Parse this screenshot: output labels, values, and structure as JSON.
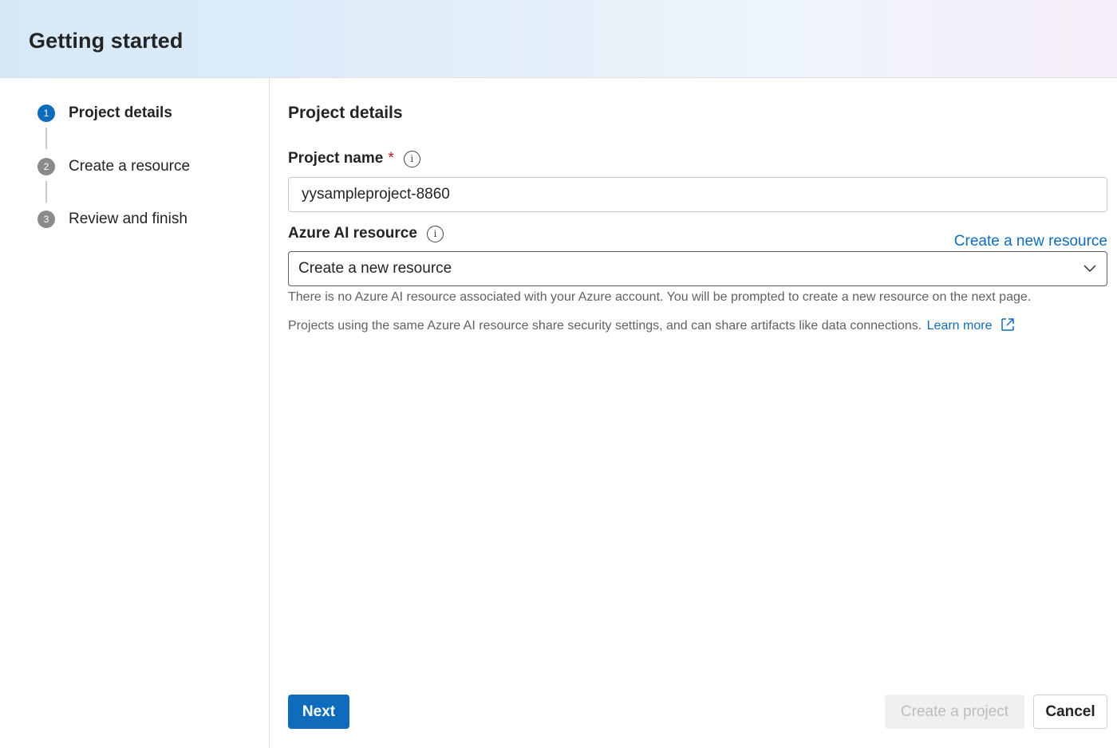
{
  "header": {
    "title": "Getting started"
  },
  "stepper": {
    "steps": [
      {
        "number": "1",
        "label": "Project details",
        "state": "active"
      },
      {
        "number": "2",
        "label": "Create a resource",
        "state": "inactive"
      },
      {
        "number": "3",
        "label": "Review and finish",
        "state": "inactive"
      }
    ]
  },
  "main": {
    "section_title": "Project details",
    "project_name": {
      "label": "Project name",
      "required_marker": "*",
      "info_glyph": "i",
      "value": "yysampleproject-8860"
    },
    "azure_resource": {
      "label": "Azure AI resource",
      "info_glyph": "i",
      "create_link": "Create a new resource",
      "selected": "Create a new resource",
      "helper_text": "There is no Azure AI resource associated with your Azure account. You will be prompted to create a new resource on the next page.",
      "note_text": "Projects using the same Azure AI resource share security settings, and can share artifacts like data connections.",
      "learn_more": "Learn more"
    }
  },
  "footer": {
    "next_label": "Next",
    "create_project_label": "Create a project",
    "cancel_label": "Cancel"
  },
  "colors": {
    "accent": "#0f6cbd",
    "required": "#c50f1f",
    "step_inactive": "#8a8a8a"
  },
  "icons": {
    "info": "info-icon",
    "dropdown": "chevron-down-icon",
    "external": "external-link-icon"
  }
}
